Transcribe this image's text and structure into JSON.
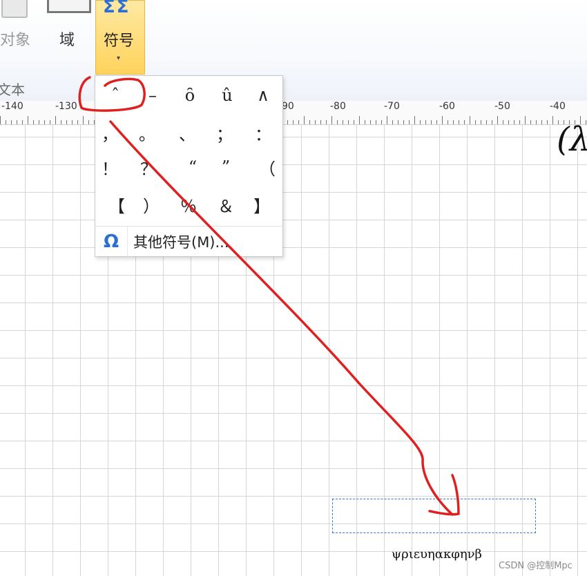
{
  "ribbon": {
    "object_label": "对象",
    "field_label": "域",
    "symbol_label": "符号",
    "symbol_icon_text": "ΣΣ",
    "dropdown_arrow": "▾",
    "group_label": "文本"
  },
  "ruler": {
    "labels": [
      "-140",
      "-130",
      "90",
      "-80",
      "-70",
      "-60",
      "-50",
      "-40"
    ]
  },
  "dropdown": {
    "symbols": [
      "ˆ",
      "–",
      "ȏ",
      "û",
      "∧",
      "，",
      "。",
      "、",
      "；",
      "：",
      "！",
      "？",
      "“",
      "”",
      "（",
      "【",
      "）",
      "％",
      "＆",
      "】"
    ],
    "more_icon": "Ω",
    "more_label": "其他符号(M)..."
  },
  "document": {
    "partial_math": "(λ",
    "greek_text": "ψριευηακφηνβ"
  },
  "watermark": "CSDN @控制Mpc",
  "colors": {
    "accent": "#2a6fd6",
    "symbol_button_bg": "#ffd35c",
    "annotation": "#e02020"
  }
}
